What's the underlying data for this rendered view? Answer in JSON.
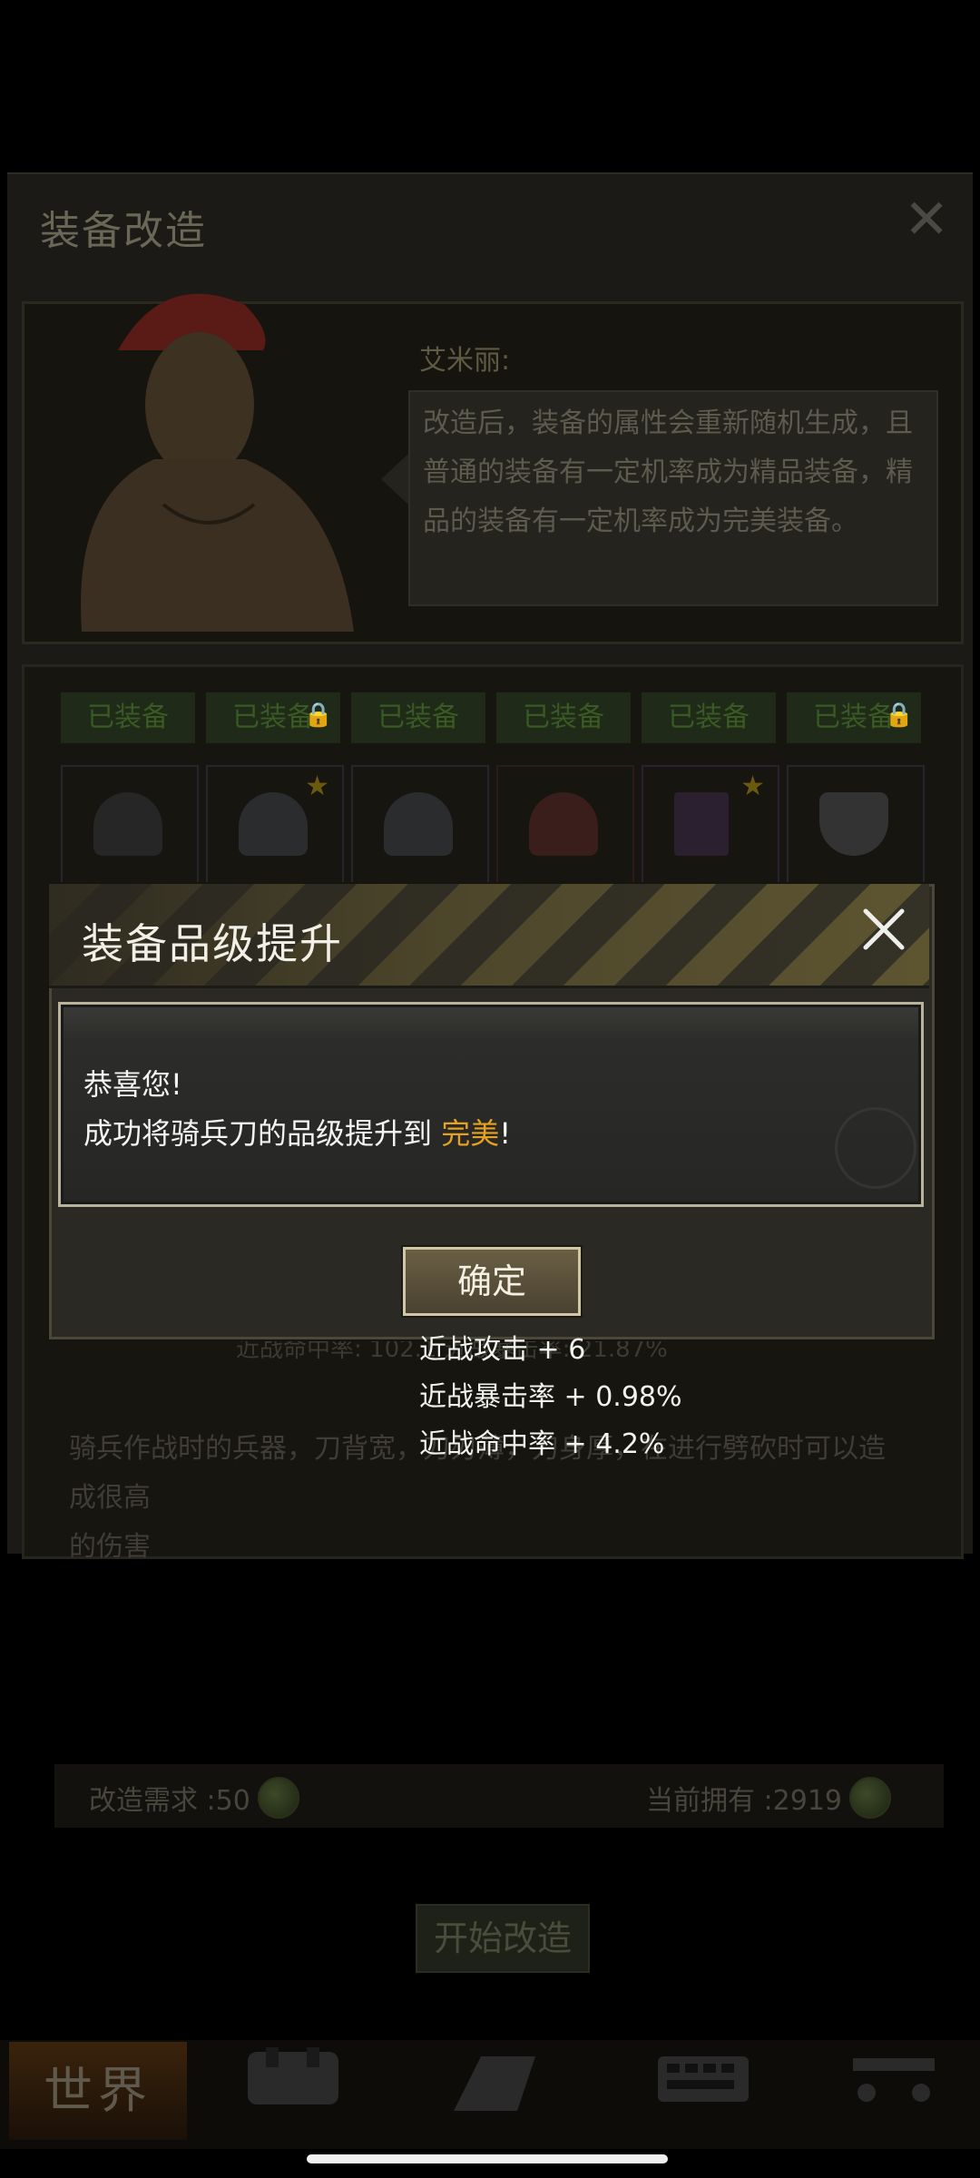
{
  "background_panel": {
    "title": "装备改造",
    "npc": {
      "name": "艾米丽:",
      "speech_lines": [
        "改造后，装备的属性会重新随机生成，且",
        "普通的装备有一定机率成为精品装备，精",
        "品的装备有一定机率成为完美装备。"
      ]
    },
    "equipment_slots": [
      {
        "label": "已装备"
      },
      {
        "label": "已装备"
      },
      {
        "label": "已装备"
      },
      {
        "label": "已装备"
      },
      {
        "label": "已装备"
      },
      {
        "label": "已装备"
      }
    ],
    "stat_summary": "近战命中率: 102.1   近战暴击率: 21.87%",
    "description_lines": [
      "骑兵作战时的兵器，刀背宽，刀刃薄，刀身厚，在进行劈砍时可以造成很高",
      "的伤害"
    ],
    "requirement_label": "改造需求 :50",
    "owned_label": "当前拥有 :2919",
    "start_button": "开始改造"
  },
  "bottom_nav": {
    "world": "世界"
  },
  "modal": {
    "title": "装备品级提升",
    "message_line1": "恭喜您!",
    "message_line2_prefix": "成功将骑兵刀的品级提升到 ",
    "message_line2_highlight": "完美",
    "message_line2_suffix": "!",
    "confirm_label": "确定",
    "stat_changes": [
      "近战攻击 + 6",
      "近战暴击率 + 0.98%",
      "近战命中率 + 4.2%"
    ]
  },
  "colors": {
    "highlight": "#e6a21e",
    "modal_bg": "#2a2924",
    "button_border": "#cfc7a6"
  }
}
